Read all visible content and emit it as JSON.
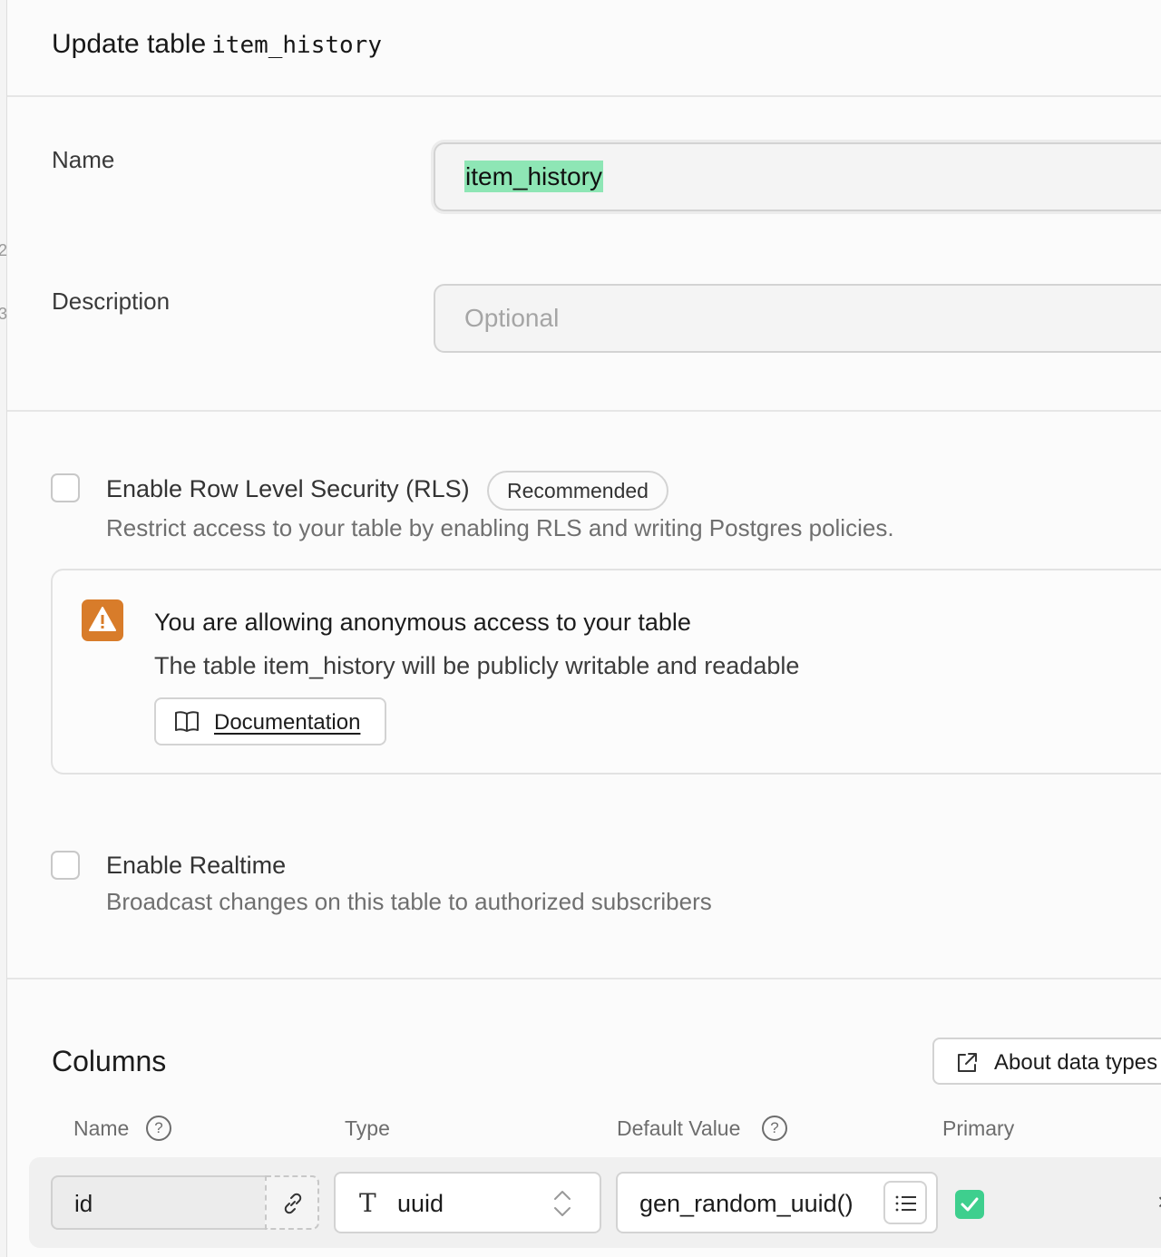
{
  "header": {
    "title_prefix": "Update table",
    "table_name": "item_history"
  },
  "edge": {
    "num_a": "2",
    "num_b": "3"
  },
  "form": {
    "name_label": "Name",
    "name_value": "item_history",
    "description_label": "Description",
    "description_placeholder": "Optional"
  },
  "rls": {
    "title": "Enable Row Level Security (RLS)",
    "badge": "Recommended",
    "description": "Restrict access to your table by enabling RLS and writing Postgres policies.",
    "checked": false
  },
  "alert": {
    "title": "You are allowing anonymous access to your table",
    "text": "The table item_history will be publicly writable and readable",
    "button_label": "Documentation",
    "icon": "warning-icon",
    "color": "#d87c2a"
  },
  "realtime": {
    "title": "Enable Realtime",
    "description": "Broadcast changes on this table to authorized subscribers",
    "checked": false
  },
  "columns": {
    "title": "Columns",
    "about_button": "About data types",
    "headers": {
      "name": "Name",
      "type": "Type",
      "default": "Default Value",
      "primary": "Primary"
    },
    "rows": [
      {
        "name": "id",
        "type": "uuid",
        "default": "gen_random_uuid()",
        "primary": true
      }
    ]
  },
  "colors": {
    "accent": "#3ecf8e",
    "selection": "#8ee6b5",
    "warning": "#d87c2a"
  }
}
